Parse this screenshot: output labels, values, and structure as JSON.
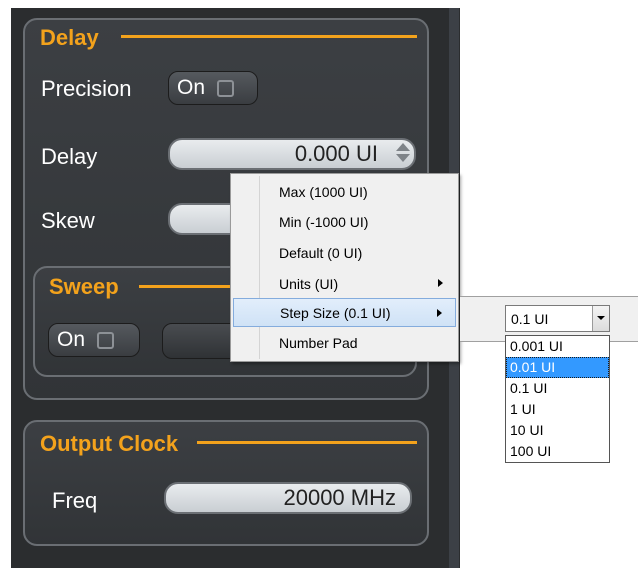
{
  "delay": {
    "title": "Delay",
    "precision_label": "Precision",
    "precision_toggle": "On",
    "delay_label": "Delay",
    "delay_value": "0.000 UI",
    "skew_label": "Skew"
  },
  "sweep": {
    "title": "Sweep",
    "toggle": "On"
  },
  "output_clock": {
    "title": "Output Clock",
    "freq_label": "Freq",
    "freq_value": "20000 MHz"
  },
  "context_menu": {
    "items": [
      {
        "label": "Max  (1000 UI)",
        "submenu": false
      },
      {
        "label": "Min  (-1000 UI)",
        "submenu": false
      },
      {
        "label": "Default  (0 UI)",
        "submenu": false
      },
      {
        "label": "Units  (UI)",
        "submenu": true
      },
      {
        "label": "Step Size  (0.1 UI)",
        "submenu": true,
        "highlighted": true
      },
      {
        "label": "Number Pad",
        "submenu": false
      }
    ]
  },
  "step_size": {
    "selected": "0.1  UI",
    "options": [
      "0.001  UI",
      "0.01  UI",
      "0.1  UI",
      "1  UI",
      "10  UI",
      "100  UI"
    ],
    "highlighted_option": "0.01  UI"
  },
  "colors": {
    "accent": "#f3a21c",
    "panel_bg": "#2b2d2f",
    "selection": "#3399ff"
  }
}
